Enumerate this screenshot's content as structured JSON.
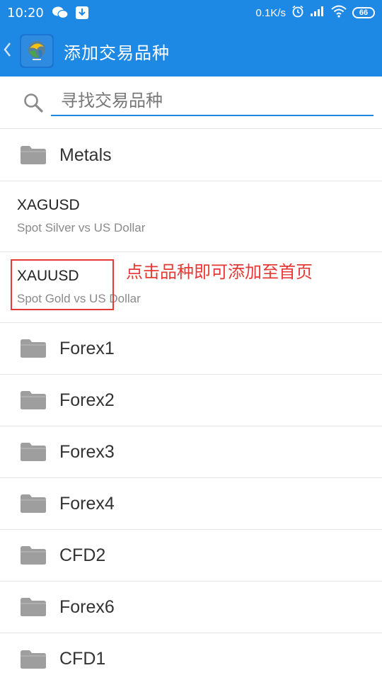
{
  "status_bar": {
    "time": "10:20",
    "net_speed": "0.1K/s",
    "battery": "66"
  },
  "app_bar": {
    "title": "添加交易品种",
    "back_icon": "chevron-left-icon",
    "logo_icon": "metatrader-logo-icon"
  },
  "search": {
    "placeholder": "寻找交易品种",
    "icon": "search-icon"
  },
  "list": {
    "metals": {
      "label": "Metals"
    },
    "xagusd": {
      "symbol": "XAGUSD",
      "description": "Spot Silver vs US Dollar"
    },
    "xauusd": {
      "symbol": "XAUUSD",
      "description": "Spot Gold vs US Dollar"
    },
    "annotation": "点击品种即可添加至首页",
    "folders": [
      "Forex1",
      "Forex2",
      "Forex3",
      "Forex4",
      "CFD2",
      "Forex6",
      "CFD1"
    ]
  },
  "colors": {
    "primary": "#1e88e5",
    "annotation_red": "#e53935",
    "folder_gray": "#9e9e9e"
  }
}
